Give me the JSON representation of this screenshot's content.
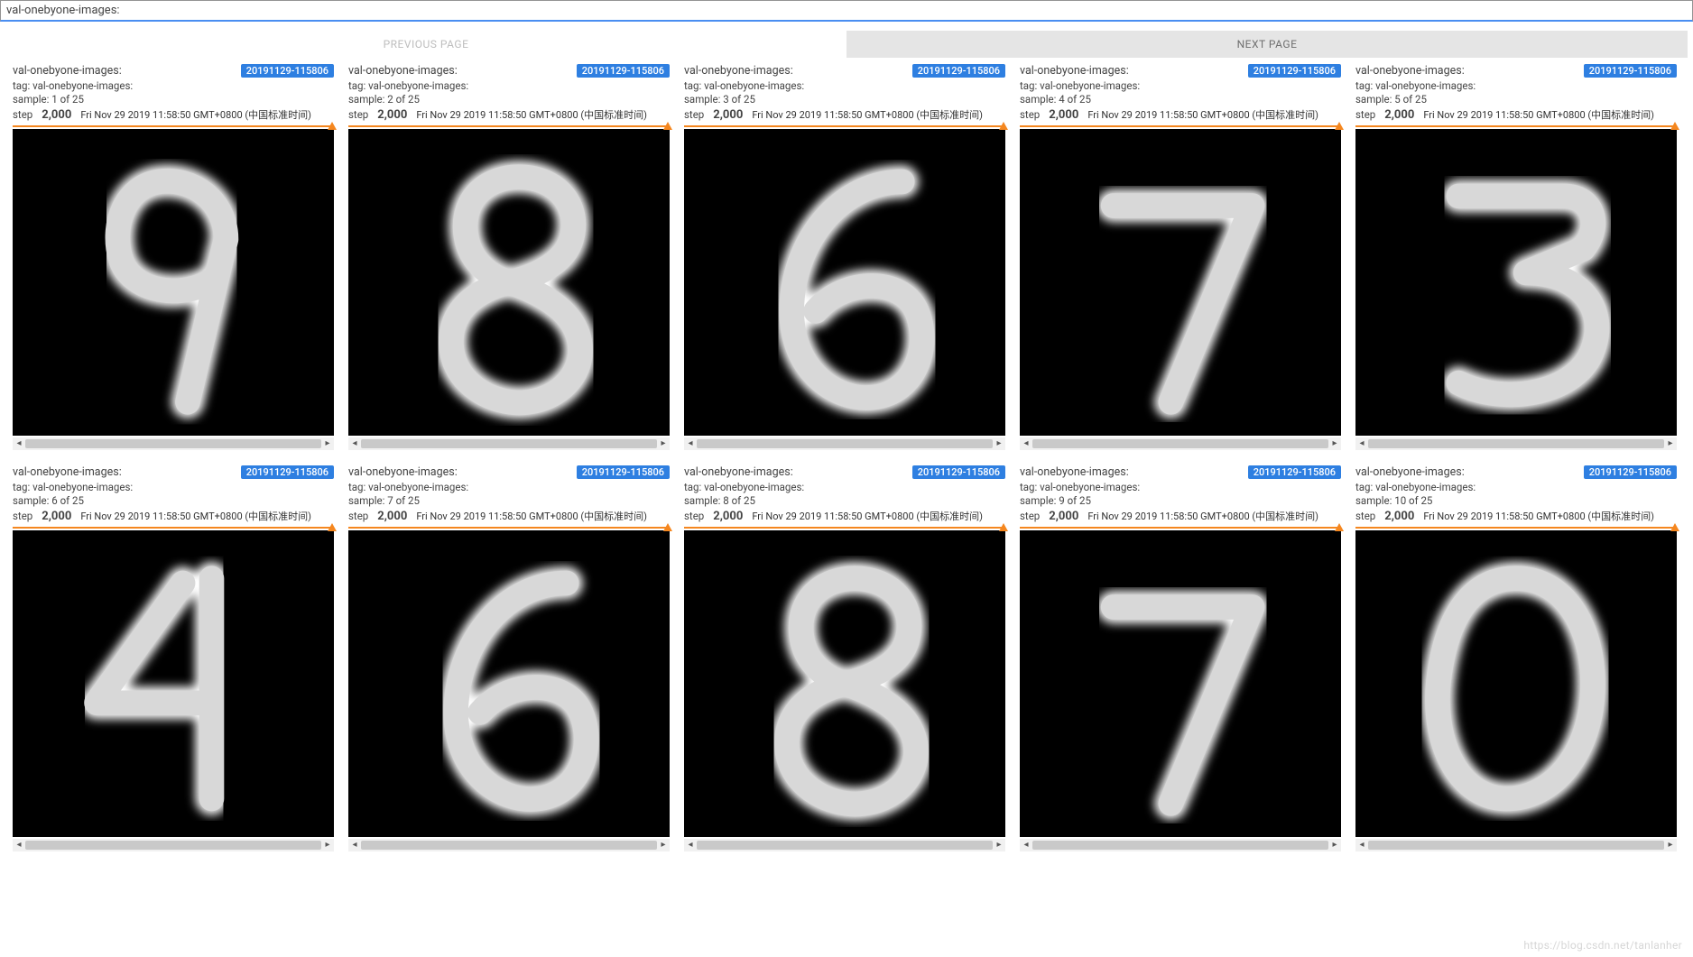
{
  "header": {
    "title": "val-onebyone-images:"
  },
  "pager": {
    "prev_label": "PREVIOUS PAGE",
    "next_label": "NEXT PAGE"
  },
  "common": {
    "title": "val-onebyone-images:",
    "tag_prefix": "tag: ",
    "tag_value": "val-onebyone-images:",
    "sample_prefix": "sample: ",
    "sample_total": "25",
    "step_label": "step",
    "step_value": "2,000",
    "timestamp": "Fri Nov 29 2019 11:58:50 GMT+0800 (中国标准时间)",
    "run_badge": "20191129-115806"
  },
  "cards": [
    {
      "sample_index": "1",
      "digit": "9"
    },
    {
      "sample_index": "2",
      "digit": "8"
    },
    {
      "sample_index": "3",
      "digit": "6"
    },
    {
      "sample_index": "4",
      "digit": "7"
    },
    {
      "sample_index": "5",
      "digit": "3"
    },
    {
      "sample_index": "6",
      "digit": "4"
    },
    {
      "sample_index": "7",
      "digit": "6"
    },
    {
      "sample_index": "8",
      "digit": "8"
    },
    {
      "sample_index": "9",
      "digit": "7"
    },
    {
      "sample_index": "10",
      "digit": "0"
    }
  ],
  "watermark": "https://blog.csdn.net/tanlanher"
}
